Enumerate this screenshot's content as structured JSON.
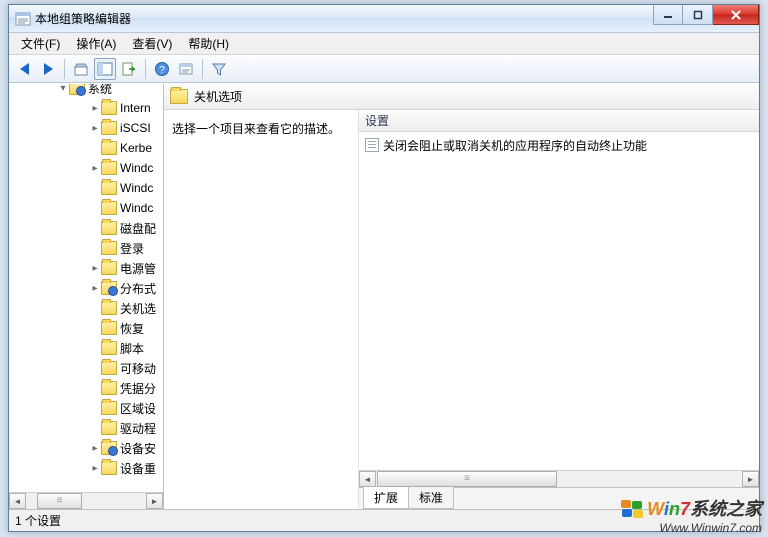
{
  "window": {
    "title": "本地组策略编辑器"
  },
  "menubar": [
    {
      "label": "文件(F)"
    },
    {
      "label": "操作(A)"
    },
    {
      "label": "查看(V)"
    },
    {
      "label": "帮助(H)"
    }
  ],
  "tree": {
    "root": {
      "label": "系统",
      "depth": 3,
      "expander": "▾",
      "blue": true
    },
    "items": [
      {
        "label": "Intern",
        "expander": "▸",
        "blue": false
      },
      {
        "label": "iSCSI",
        "expander": "▸",
        "blue": false
      },
      {
        "label": "Kerbe",
        "expander": "",
        "blue": false
      },
      {
        "label": "Windc",
        "expander": "▸",
        "blue": false
      },
      {
        "label": "Windc",
        "expander": "",
        "blue": false
      },
      {
        "label": "Windc",
        "expander": "",
        "blue": false
      },
      {
        "label": "磁盘配",
        "expander": "",
        "blue": false
      },
      {
        "label": "登录",
        "expander": "",
        "blue": false
      },
      {
        "label": "电源管",
        "expander": "▸",
        "blue": false
      },
      {
        "label": "分布式",
        "expander": "▸",
        "blue": true
      },
      {
        "label": "关机选",
        "expander": "",
        "blue": false
      },
      {
        "label": "恢复",
        "expander": "",
        "blue": false
      },
      {
        "label": "脚本",
        "expander": "",
        "blue": false
      },
      {
        "label": "可移动",
        "expander": "",
        "blue": false
      },
      {
        "label": "凭据分",
        "expander": "",
        "blue": false
      },
      {
        "label": "区域设",
        "expander": "",
        "blue": false
      },
      {
        "label": "驱动程",
        "expander": "",
        "blue": false
      },
      {
        "label": "设备安",
        "expander": "▸",
        "blue": true
      },
      {
        "label": "设备重",
        "expander": "▸",
        "blue": false
      }
    ]
  },
  "right": {
    "title": "关机选项",
    "desc": "选择一个项目来查看它的描述。",
    "column": "设置",
    "rows": [
      "关闭会阻止或取消关机的应用程序的自动终止功能"
    ],
    "tabs": {
      "extended": "扩展",
      "standard": "标准"
    }
  },
  "statusbar": "1 个设置",
  "watermark": {
    "brand_cn": "系统之家",
    "url": "Www.Winwin7.com"
  }
}
